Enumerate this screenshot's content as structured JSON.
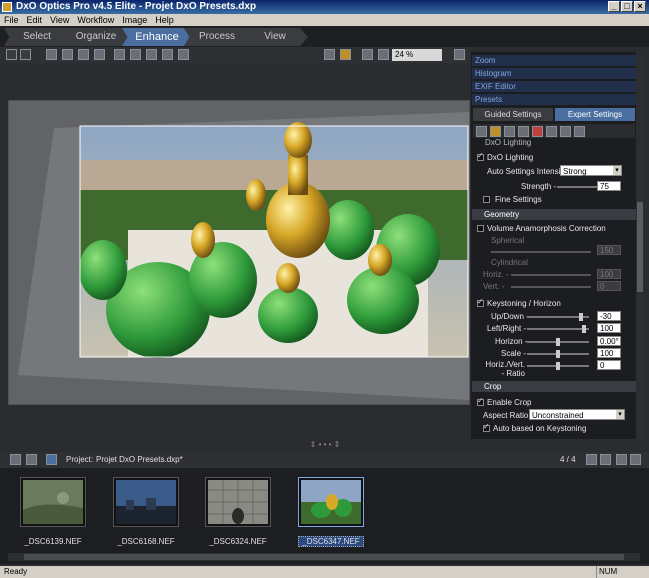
{
  "window": {
    "title": "DxO Optics Pro v4.5 Elite - Projet DxO Presets.dxp"
  },
  "menu": [
    "File",
    "Edit",
    "View",
    "Workflow",
    "Image",
    "Help"
  ],
  "tabs": [
    {
      "label": "Select",
      "active": false
    },
    {
      "label": "Organize",
      "active": false
    },
    {
      "label": "Enhance",
      "active": true
    },
    {
      "label": "Process",
      "active": false
    },
    {
      "label": "View",
      "active": false
    }
  ],
  "toolbar": {
    "zoom_value": "24 %"
  },
  "palette_headers": [
    "Zoom",
    "Histogram",
    "EXIF Editor",
    "Presets"
  ],
  "settings_tabs": {
    "guided": "Guided Settings",
    "expert": "Expert Settings",
    "active": "expert"
  },
  "lighting": {
    "section_cut": "DxO Lighting",
    "dxo_lighting_label": "DxO Lighting",
    "auto_intensity_label": "Auto Settings Intensity",
    "auto_intensity_value": "Strong",
    "strength_label": "Strength -",
    "strength_value": "75",
    "fine_settings_label": "Fine Settings"
  },
  "geometry": {
    "header": "Geometry",
    "volume_label": "Volume Anamorphosis Correction",
    "spherical_label": "Spherical",
    "spherical_value": "150",
    "cylindrical_label": "Cylindrical",
    "horiz_label": "Horiz. -",
    "horiz_value": "100",
    "vert_label": "Vert. -",
    "vert_value": "0",
    "keystoning_label": "Keystoning / Horizon",
    "updown_label": "Up/Down -",
    "updown_value": "-30",
    "leftright_label": "Left/Right -",
    "leftright_value": "100",
    "horizon_label": "Horizon -",
    "horizon_value": "0.00°",
    "scale_label": "Scale -",
    "scale_value": "100",
    "ratio_label": "Horiz./Vert. - Ratio",
    "ratio_value": "0"
  },
  "crop": {
    "header": "Crop",
    "enable_label": "Enable Crop",
    "aspect_label": "Aspect Ratio",
    "aspect_value": "Unconstrained",
    "auto_label": "Auto based on Keystoning"
  },
  "project": {
    "label": "Project:",
    "name": "Projet DxO Presets.dxp*",
    "count": "4 / 4"
  },
  "thumbnails": [
    {
      "name": "_DSC6139.NEF",
      "selected": false
    },
    {
      "name": "_DSC6168.NEF",
      "selected": false
    },
    {
      "name": "_DSC6324.NEF",
      "selected": false
    },
    {
      "name": "_DSC6347.NEF",
      "selected": true
    }
  ],
  "status": {
    "left": "Ready",
    "num": "NUM"
  },
  "colors": {
    "accent": "#4a6ea0",
    "panel_header": "#7fa6e0"
  }
}
